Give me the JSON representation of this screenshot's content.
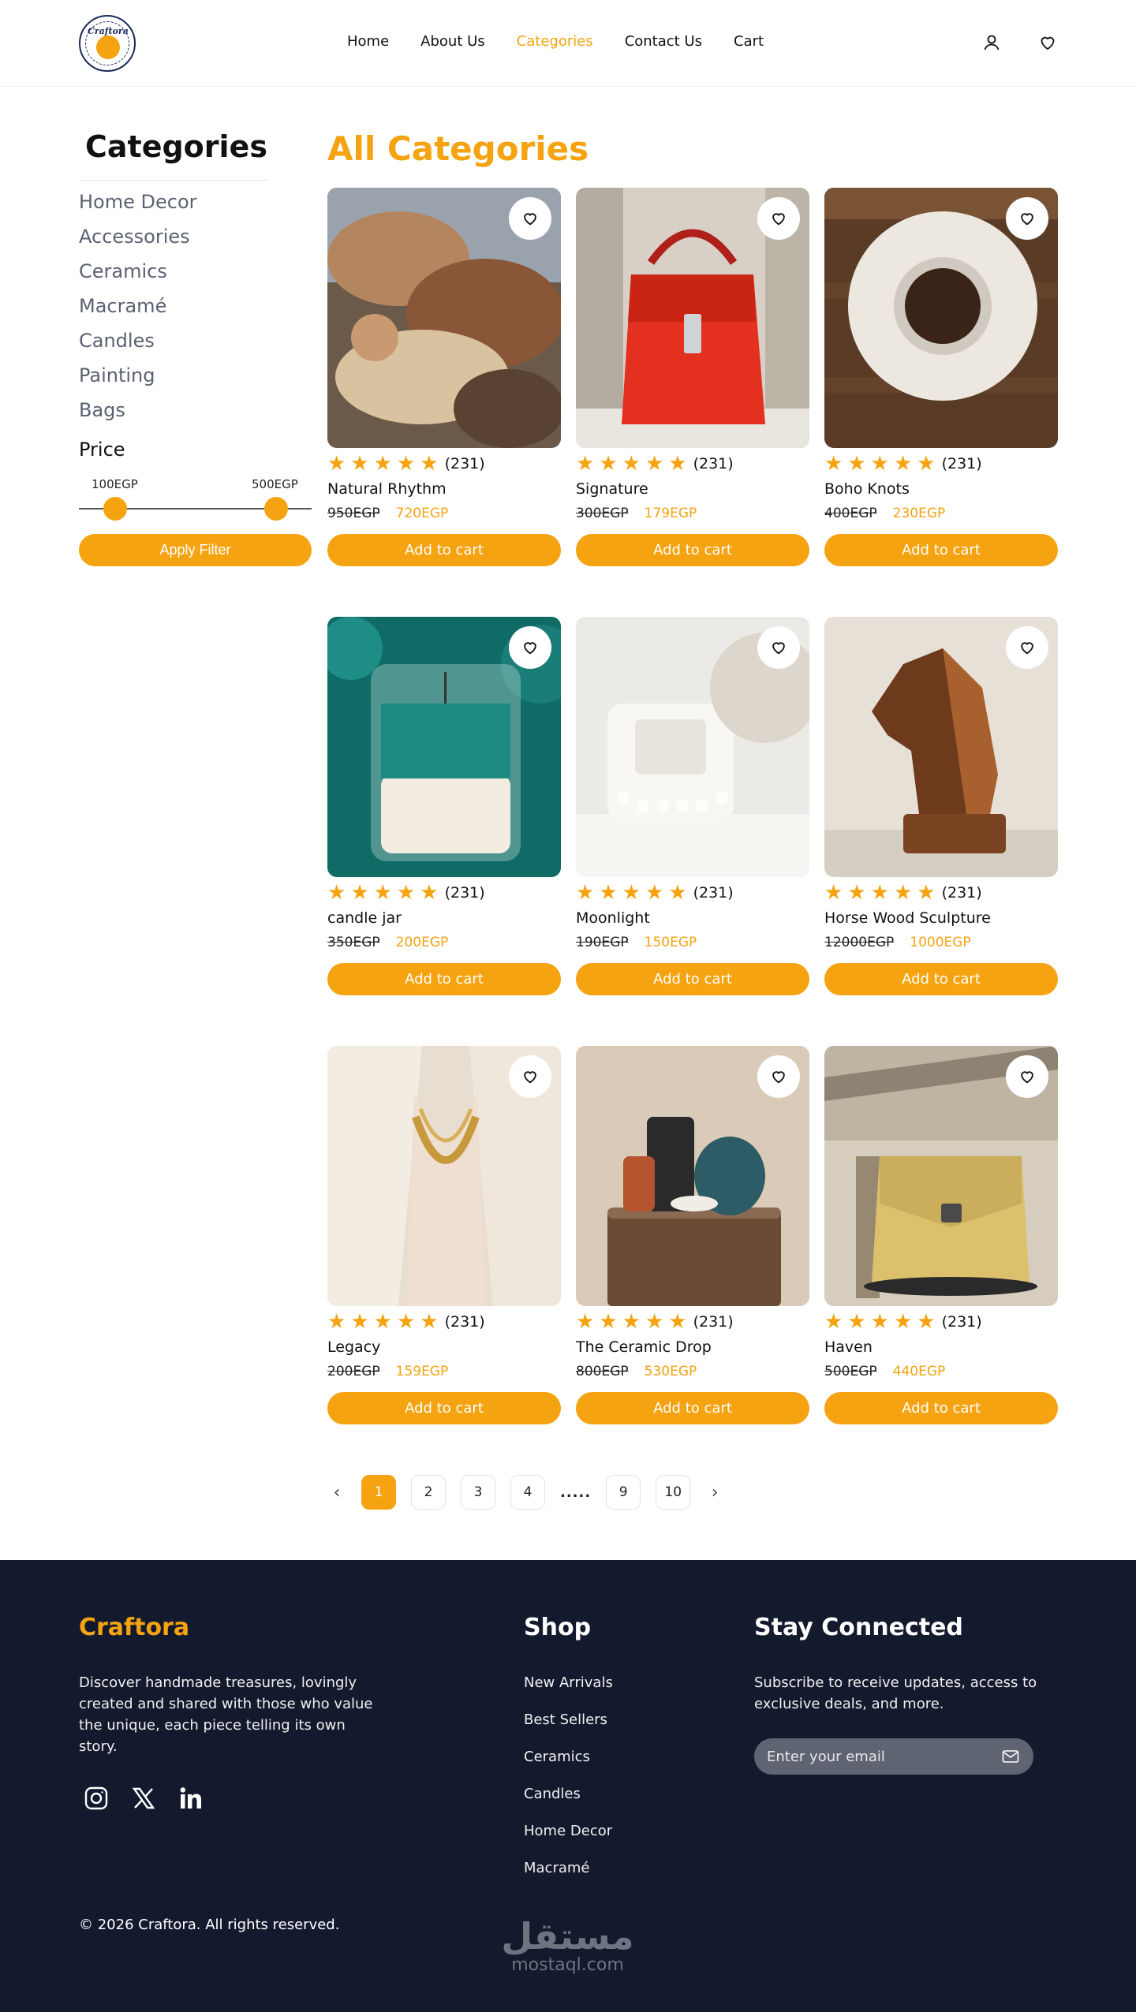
{
  "header": {
    "logo_text": "Craftora",
    "nav": [
      {
        "label": "Home",
        "active": false
      },
      {
        "label": "About Us",
        "active": false
      },
      {
        "label": "Categories",
        "active": true
      },
      {
        "label": "Contact Us",
        "active": false
      },
      {
        "label": "Cart",
        "active": false
      }
    ],
    "icons": [
      "user-icon",
      "heart-icon"
    ]
  },
  "sidebar": {
    "title": "Categories",
    "categories": [
      "Home Decor",
      "Accessories",
      "Ceramics",
      "Macramé",
      "Candles",
      "Painting",
      "Bags"
    ],
    "price": {
      "title": "Price",
      "min_label": "100EGP",
      "max_label": "500EGP"
    },
    "apply_label": "Apply Filter"
  },
  "main": {
    "title": "All Categories",
    "add_to_cart_label": "Add to cart",
    "products": [
      {
        "name": "Natural Rhythm",
        "old_price": "950EGP",
        "new_price": "720EGP",
        "rating": 5,
        "reviews": "(231)"
      },
      {
        "name": "Signature",
        "old_price": "300EGP",
        "new_price": "179EGP",
        "rating": 5,
        "reviews": "(231)"
      },
      {
        "name": "Boho Knots",
        "old_price": "400EGP",
        "new_price": "230EGP",
        "rating": 5,
        "reviews": "(231)"
      },
      {
        "name": "candle jar",
        "old_price": "350EGP",
        "new_price": "200EGP",
        "rating": 5,
        "reviews": "(231)"
      },
      {
        "name": "Moonlight",
        "old_price": "190EGP",
        "new_price": "150EGP",
        "rating": 5,
        "reviews": "(231)"
      },
      {
        "name": "Horse Wood Sculpture",
        "old_price": "12000EGP",
        "new_price": "1000EGP",
        "rating": 5,
        "reviews": "(231)"
      },
      {
        "name": "Legacy",
        "old_price": "200EGP",
        "new_price": "159EGP",
        "rating": 5,
        "reviews": "(231)"
      },
      {
        "name": "The Ceramic Drop",
        "old_price": "800EGP",
        "new_price": "530EGP",
        "rating": 5,
        "reviews": "(231)"
      },
      {
        "name": "Haven",
        "old_price": "500EGP",
        "new_price": "440EGP",
        "rating": 5,
        "reviews": "(231)"
      }
    ]
  },
  "pagination": {
    "pages": [
      "1",
      "2",
      "3",
      "4",
      "9",
      "10"
    ],
    "ellipsis": ".....",
    "current": "1"
  },
  "footer": {
    "brand": "Craftora",
    "description": "Discover handmade treasures, lovingly created and shared with those who value the unique, each piece telling its own story.",
    "shop_title": "Shop",
    "shop_links": [
      "New Arrivals",
      "Best Sellers",
      "Ceramics",
      "Candles",
      "Home Decor",
      "Macramé"
    ],
    "stay_title": "Stay Connected",
    "stay_description": "Subscribe to receive updates, access to exclusive deals, and more.",
    "email_placeholder": "Enter your email",
    "copyright": "© 2026 Craftora. All rights reserved.",
    "watermark_arabic": "مستقل",
    "watermark_latin": "mostaql.com"
  },
  "colors": {
    "accent": "#f5a310",
    "footer_bg": "#141a2e",
    "sidebar_text": "#5b6170"
  }
}
